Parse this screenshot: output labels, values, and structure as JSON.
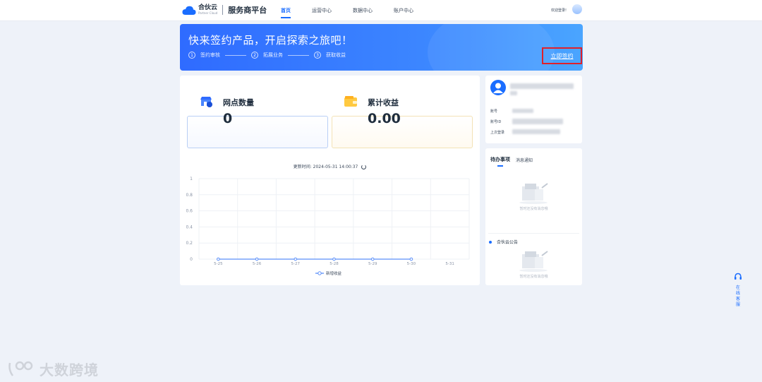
{
  "header": {
    "logo_name": "合伙云",
    "logo_sub": "Partner Cloud",
    "platform": "服务商平台",
    "nav": [
      "首页",
      "运营中心",
      "数据中心",
      "账户中心"
    ],
    "welcome": "欢迎登录!"
  },
  "banner": {
    "title": "快来签约产品，开启探索之旅吧！",
    "steps": [
      {
        "num": "1",
        "label": "签约审核"
      },
      {
        "num": "2",
        "label": "拓展业务"
      },
      {
        "num": "3",
        "label": "获取收益"
      }
    ],
    "sign_button": "立即签约"
  },
  "stats": [
    {
      "title": "网点数量",
      "value": "0"
    },
    {
      "title": "累计收益",
      "value": "0.00"
    }
  ],
  "update": {
    "label": "更新时间:",
    "time": "2024-05-31 14:00:37"
  },
  "chart_data": {
    "type": "line",
    "categories": [
      "5-25",
      "5-26",
      "5-27",
      "5-28",
      "5-29",
      "5-30",
      "5-31"
    ],
    "series": [
      {
        "name": "新增收益",
        "values": [
          0,
          0,
          0,
          0,
          0,
          0,
          null
        ]
      }
    ],
    "y_ticks": [
      "0",
      "0.2",
      "0.4",
      "0.6",
      "0.8",
      "1"
    ],
    "ylim": [
      0,
      1
    ],
    "grid": true,
    "legend": "bottom-center",
    "color": "#5b8ff9"
  },
  "user": {
    "labels": [
      "账号",
      "账号ID",
      "上次登录"
    ]
  },
  "todo": {
    "tabs": [
      "待办事项",
      "消息通知"
    ],
    "empty_text": "暂时还没有消息哦",
    "notice_title": "合伙云公告",
    "notice_empty_text": "暂时还没有消息哦"
  },
  "float": {
    "label": [
      "在",
      "线",
      "客",
      "服"
    ]
  },
  "watermark": "大数跨境",
  "colors": {
    "primary": "#1a6dff",
    "banner_start": "#2f6bff",
    "banner_end": "#4aa5ff",
    "highlight": "#e0202a"
  }
}
